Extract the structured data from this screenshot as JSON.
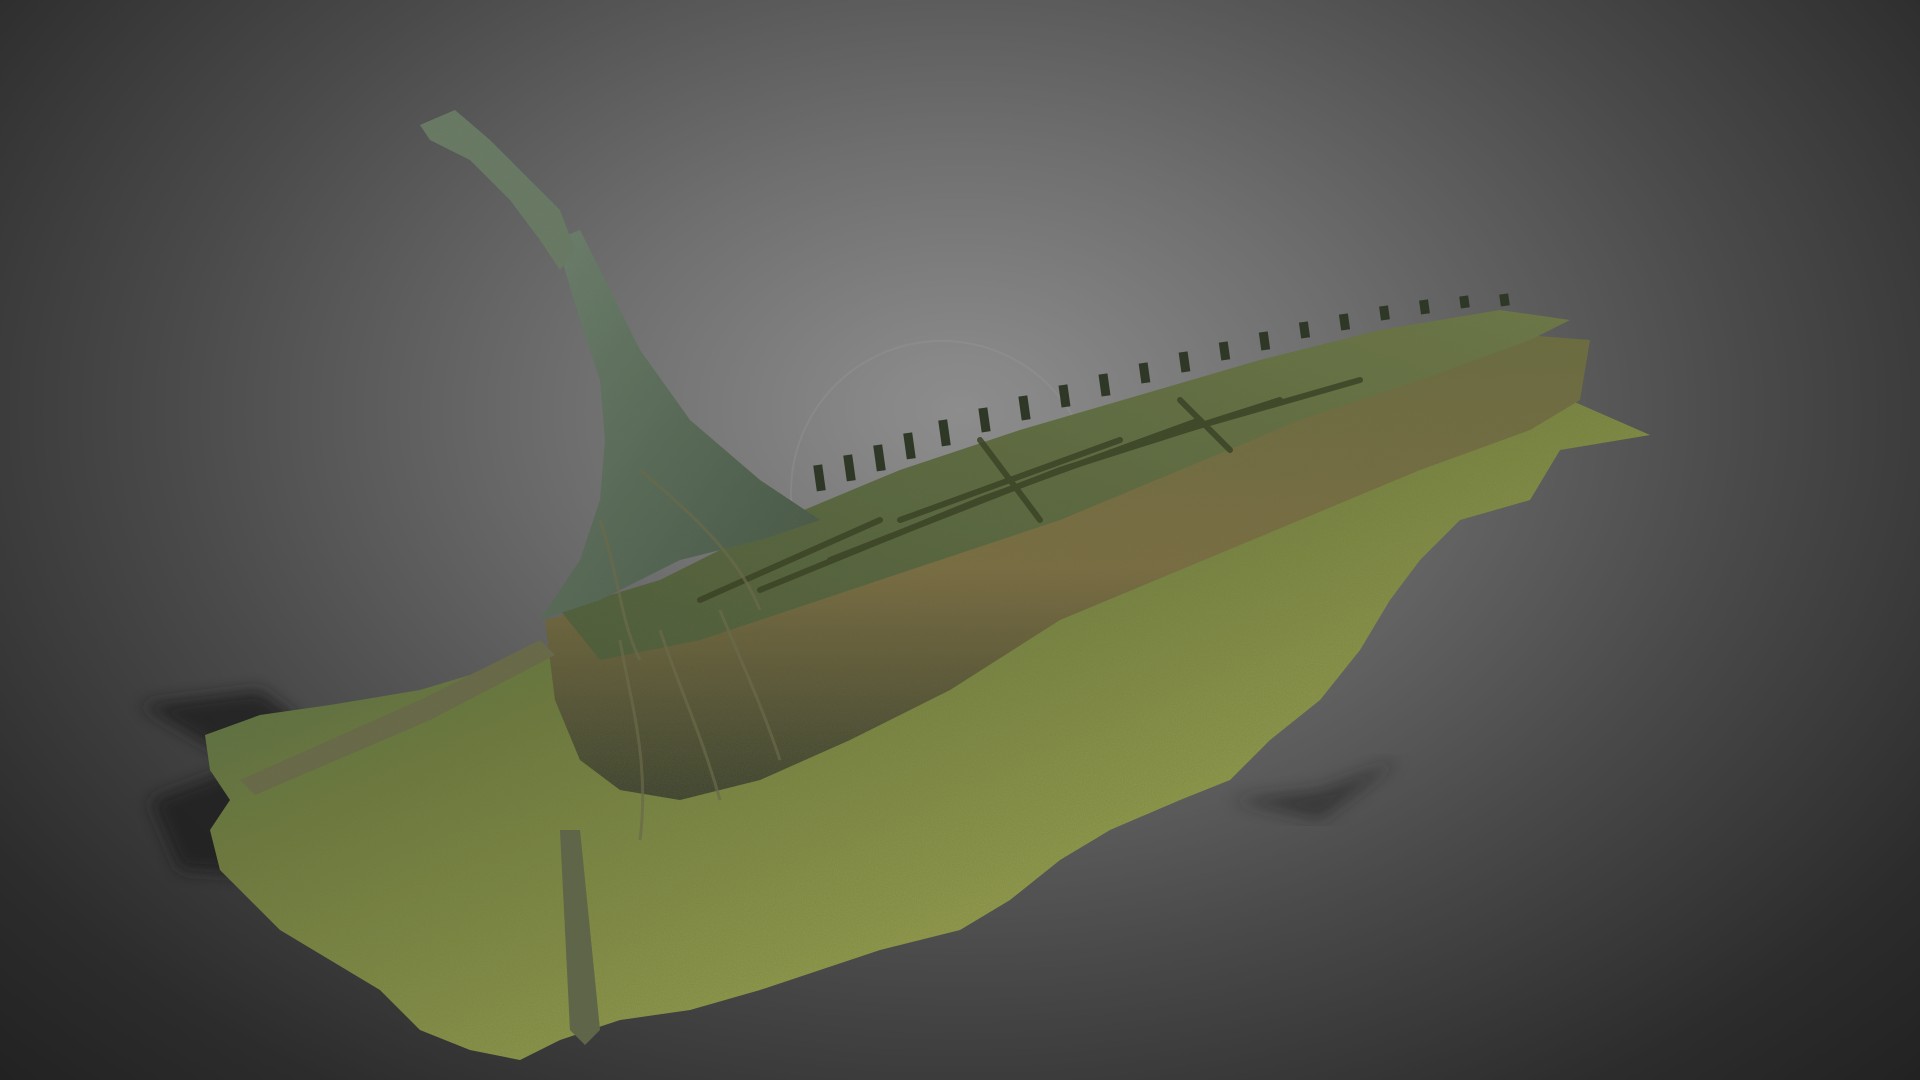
{
  "viewer": {
    "background_center": "#8e8e8e",
    "background_edge": "#222222"
  },
  "model": {
    "subject": "shipwreck-model",
    "colors": {
      "seabed_light": "#9aa24a",
      "seabed_mid": "#6f7d3a",
      "seabed_dark": "#2f4a3a",
      "hull_light": "#7f7a44",
      "hull_mid": "#5e5c33",
      "hull_dark": "#3a3e28",
      "bowsprit": "#5f7360",
      "deck": "#55653a",
      "shadow": "#1c1c1c"
    }
  }
}
